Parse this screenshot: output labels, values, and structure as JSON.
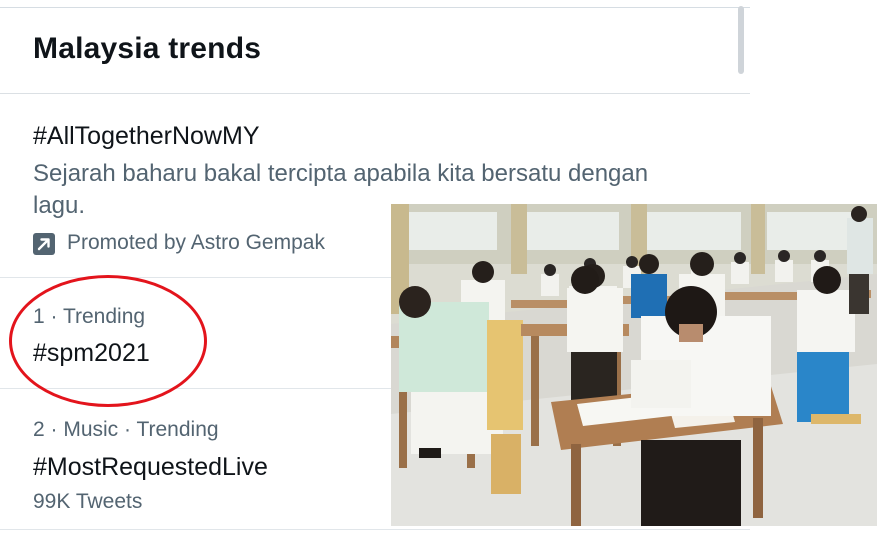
{
  "panel": {
    "title": "Malaysia trends"
  },
  "promoted_item": {
    "hashtag": "#AllTogetherNowMY",
    "description": "Sejarah baharu bakal tercipta apabila kita bersatu dengan lagu.",
    "promoted_by": "Promoted by Astro Gempak",
    "icon": "promoted-arrow-icon"
  },
  "trends": [
    {
      "meta": "1 · Trending",
      "hashtag": "#spm2021",
      "count": ""
    },
    {
      "meta": "2 · Music · Trending",
      "hashtag": "#MostRequestedLive",
      "count": "99K Tweets"
    }
  ],
  "annotation": {
    "color": "#e3141c"
  },
  "photo": {
    "subject": "students sitting an exam in a hall"
  },
  "colors": {
    "primary_text": "#0f1419",
    "secondary_text": "#536471",
    "divider": "#e1e6ea"
  }
}
